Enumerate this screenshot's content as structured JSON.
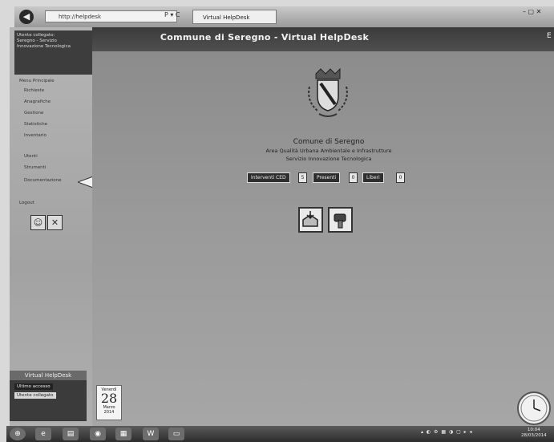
{
  "browser": {
    "address": "http://helpdesk",
    "address_icons": "P ▾ C",
    "tab_label": "Virtual HelpDesk",
    "window_controls": "– ▢ ✕"
  },
  "header": {
    "title": "Commune di Seregno - Virtual HelpDesk",
    "right_glyph": "E"
  },
  "sidebar": {
    "logo_lines": [
      "Utente collegato:",
      "Seregno - Servizio",
      "Innovazione Tecnologica"
    ],
    "items": [
      "Menu Principale",
      "Richieste",
      "Anagrafiche",
      "Gestione",
      "Statistiche",
      "Inventario",
      "Utenti",
      "Strumenti",
      "Documentazione",
      "Logout"
    ],
    "role_icons": [
      "user-icon",
      "tools-icon"
    ]
  },
  "widget": {
    "title": "Virtual HelpDesk",
    "line1": "Ultimo accesso",
    "line2": "Utente collegato"
  },
  "calendar": {
    "day_of_week": "Venerdì",
    "day": "28",
    "month": "Marzo",
    "year": "2014"
  },
  "main": {
    "org_title": "Comune di Seregno",
    "org_subtitle1": "Area Qualità Urbana Ambientale e Infrastrutture",
    "org_subtitle2": "Servizio Innovazione Tecnologica",
    "counters": [
      {
        "label": "Interventi CED",
        "value": "5"
      },
      {
        "label": "Presenti",
        "value": "0"
      },
      {
        "label": "Liberi",
        "value": "0"
      }
    ],
    "action_buttons": [
      "inbox-icon",
      "hammer-icon"
    ]
  },
  "taskbar": {
    "apps": [
      "⊕",
      "e",
      "▤",
      "◉",
      "▦",
      "W",
      "▭"
    ],
    "tray_icons": "▴ ◐ ⚙ ▦ ◑ ▢ ▸ ◂",
    "time": "10:04",
    "date": "28/03/2014"
  },
  "colors": {
    "header_bg": "#3a3a3a",
    "main_bg": "#9a9a9a",
    "sidebar_bg": "#aaaaaa"
  }
}
